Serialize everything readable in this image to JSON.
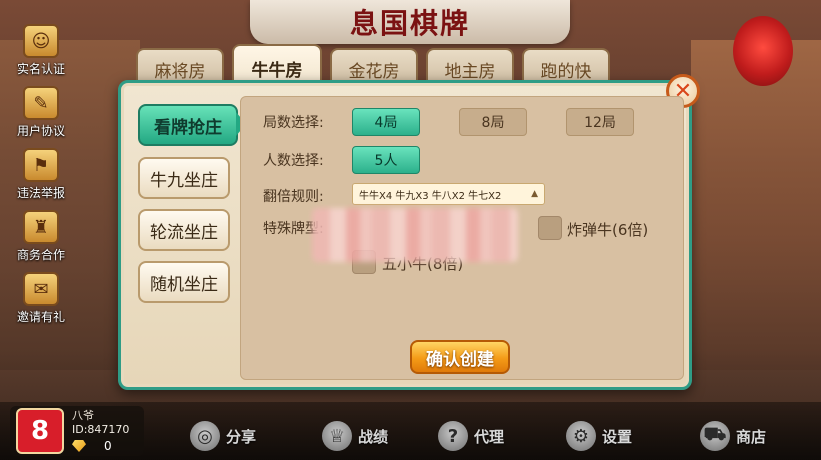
{
  "app": {
    "title": "息国棋牌"
  },
  "side_menu": [
    {
      "label": "实名认证",
      "icon": "id-card-icon",
      "glyph": "☺"
    },
    {
      "label": "用户协议",
      "icon": "clipboard-icon",
      "glyph": "✎"
    },
    {
      "label": "违法举报",
      "icon": "police-badge-icon",
      "glyph": "⚑"
    },
    {
      "label": "商务合作",
      "icon": "handshake-icon",
      "glyph": "♜"
    },
    {
      "label": "邀请有礼",
      "icon": "gift-icon",
      "glyph": "✉"
    }
  ],
  "tabs": [
    {
      "label": "麻将房",
      "active": false
    },
    {
      "label": "牛牛房",
      "active": true
    },
    {
      "label": "金花房",
      "active": false
    },
    {
      "label": "地主房",
      "active": false
    },
    {
      "label": "跑的快",
      "active": false
    }
  ],
  "modes": [
    {
      "label": "看牌抢庄",
      "active": true
    },
    {
      "label": "牛九坐庄",
      "active": false
    },
    {
      "label": "轮流坐庄",
      "active": false
    },
    {
      "label": "随机坐庄",
      "active": false
    }
  ],
  "form": {
    "rounds_label": "局数选择:",
    "rounds_options": [
      {
        "label": "4局",
        "selected": true
      },
      {
        "label": "8局",
        "selected": false
      },
      {
        "label": "12局",
        "selected": false
      }
    ],
    "players_label": "人数选择:",
    "players_options": [
      {
        "label": "5人",
        "selected": true
      }
    ],
    "multiplier_label": "翻倍规则:",
    "multiplier_value": "牛牛X4 牛九X3 牛八X2 牛七X2",
    "special_label": "特殊牌型:",
    "special_options": [
      {
        "label": "炸弹牛(6倍)",
        "checked": false
      },
      {
        "label": "五小牛(8倍)",
        "checked": false
      }
    ]
  },
  "confirm_label": "确认创建",
  "close_glyph": "✕",
  "profile": {
    "name": "八爷",
    "id_text": "ID:847170",
    "gems": "0",
    "avatar_glyph": "8"
  },
  "bottom_nav": [
    {
      "label": "分享",
      "icon": "share-icon",
      "glyph": "◎"
    },
    {
      "label": "战绩",
      "icon": "trophy-icon",
      "glyph": "♕"
    },
    {
      "label": "代理",
      "icon": "question-icon",
      "glyph": "?"
    },
    {
      "label": "设置",
      "icon": "gear-icon",
      "glyph": "⚙"
    },
    {
      "label": "商店",
      "icon": "cart-icon",
      "glyph": "⛟"
    }
  ],
  "colors": {
    "accent_green": "#2cb08b",
    "dialog_border": "#2f9c86",
    "confirm_orange": "#f49b17",
    "title_red": "#7b1212"
  }
}
